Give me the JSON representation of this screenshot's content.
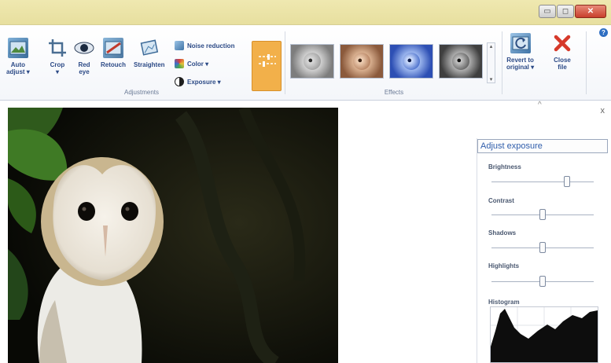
{
  "ribbon": {
    "adjustments_group": {
      "label": "Adjustments",
      "tools": [
        {
          "label": "Auto\nadjust ▾",
          "icon": "auto-adjust-icon"
        },
        {
          "label": "Crop\n▾",
          "icon": "crop-icon"
        },
        {
          "label": "Red\neye",
          "icon": "red-eye-icon"
        },
        {
          "label": "Retouch",
          "icon": "retouch-icon"
        },
        {
          "label": "Straighten",
          "icon": "straighten-icon"
        }
      ],
      "small_commands": [
        {
          "label": "Noise reduction",
          "icon": "noise-reduction-icon"
        },
        {
          "label": "Color ▾",
          "icon": "color-icon"
        },
        {
          "label": "Exposure ▾",
          "icon": "exposure-icon"
        }
      ],
      "fine_tune_icon": "fine-tune-sliders-icon"
    },
    "effects_group": {
      "label": "Effects",
      "thumbnails": [
        {
          "icon": "effect-grayscale-icon",
          "tint": "#8a8a8a"
        },
        {
          "icon": "effect-sepia-icon",
          "tint": "#b07a58"
        },
        {
          "icon": "effect-cyan-icon",
          "tint": "#3f66c8"
        },
        {
          "icon": "effect-dark-icon",
          "tint": "#5a5a5a"
        }
      ]
    },
    "manage_group": {
      "revert_label": "Revert to\noriginal ▾",
      "close_label": "Close\nfile"
    }
  },
  "window": {
    "minimize_glyph": "▭",
    "maximize_glyph": "◻",
    "close_glyph": "✕",
    "help_glyph": "?"
  },
  "pane": {
    "title": "Adjust exposure",
    "collapse_glyph": "^",
    "close_glyph": "x",
    "sliders": [
      {
        "label": "Brightness",
        "value": 0.74
      },
      {
        "label": "Contrast",
        "value": 0.5
      },
      {
        "label": "Shadows",
        "value": 0.5
      },
      {
        "label": "Highlights",
        "value": 0.5
      }
    ],
    "histogram_label": "Histogram"
  },
  "colors": {
    "accent": "#f2b04a",
    "title_bar": "#e9e2a6",
    "close_x": "#d6392a"
  }
}
